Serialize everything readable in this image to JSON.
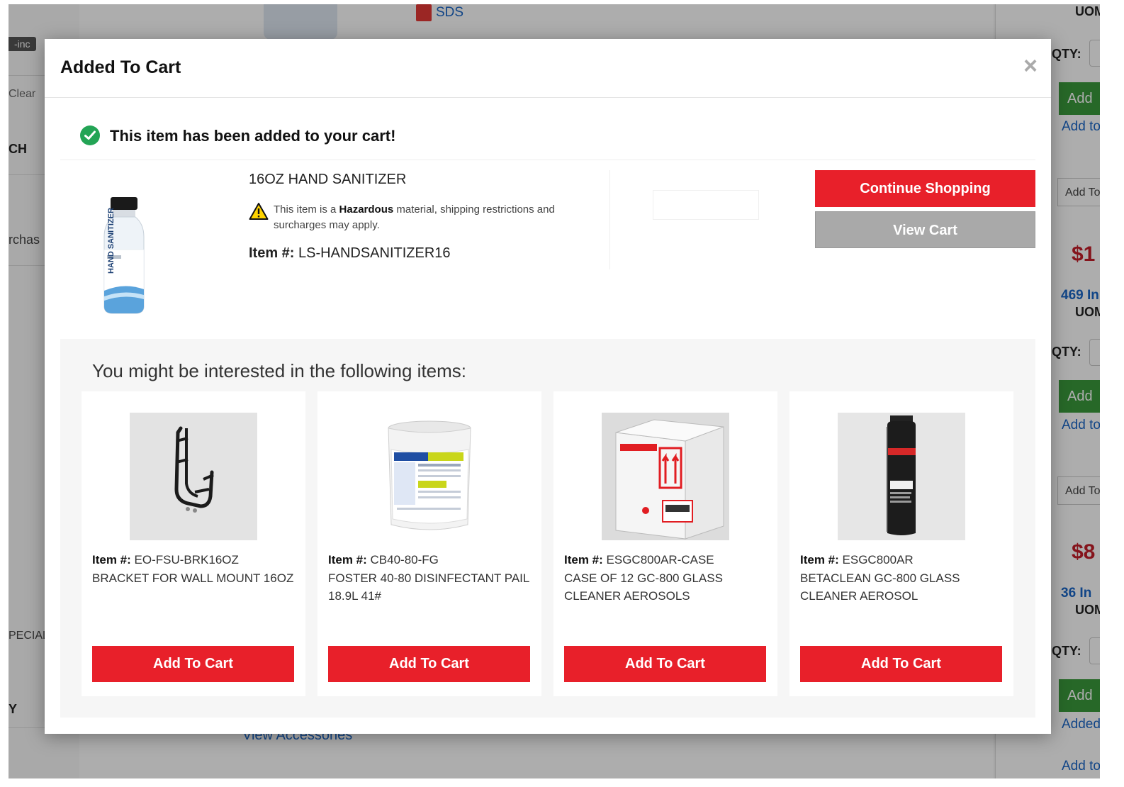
{
  "background": {
    "chip_label": "-inc",
    "clear_label": "Clear",
    "sidebar_heading_1": "CH",
    "sidebar_text_1": "rchas",
    "sidebar_heading_2": "PECIAL",
    "sidebar_heading_3": "Y",
    "sds_label": "SDS",
    "view_accessories": "View Accessories",
    "right": {
      "uom": "UOM",
      "qty": "QTY:",
      "add": "Add",
      "add_to": "Add to",
      "add_to_box": "Add To",
      "price_1": "$1",
      "stock_1": "469 In",
      "price_2": "$8",
      "stock_2": "36 In",
      "added": "Added"
    }
  },
  "modal": {
    "title": "Added To Cart",
    "close_symbol": "×",
    "success_message": "This item has been added to your cart!",
    "product": {
      "name": "16OZ HAND SANITIZER",
      "warning_prefix": "This item is a",
      "warning_bold": "Hazardous",
      "warning_suffix": "material, shipping restrictions and surcharges may apply.",
      "item_label": "Item #:",
      "item_number": "LS-HANDSANITIZER16",
      "image_text": "HAND SANITIZER"
    },
    "buttons": {
      "continue_shopping": "Continue Shopping",
      "view_cart": "View Cart"
    },
    "recommendations": {
      "title": "You might be interested in the following items:",
      "item_label": "Item #:",
      "add_to_cart": "Add To Cart",
      "items": [
        {
          "item_number": "EO-FSU-BRK16OZ",
          "description": "BRACKET FOR WALL MOUNT 16OZ"
        },
        {
          "item_number": "CB40-80-FG",
          "description": "FOSTER 40-80 DISINFECTANT PAIL 18.9L 41#"
        },
        {
          "item_number": "ESGC800AR-CASE",
          "description": "CASE OF 12 GC-800 GLASS CLEANER AEROSOLS"
        },
        {
          "item_number": "ESGC800AR",
          "description": "BETACLEAN GC-800 GLASS CLEANER AEROSOL"
        }
      ]
    }
  },
  "colors": {
    "accent_red": "#e8202a",
    "success_green": "#23a455",
    "view_cart_gray": "#a9a9a9"
  },
  "icons": [
    "check-circle-icon",
    "warning-triangle-icon",
    "close-icon",
    "pdf-icon"
  ]
}
